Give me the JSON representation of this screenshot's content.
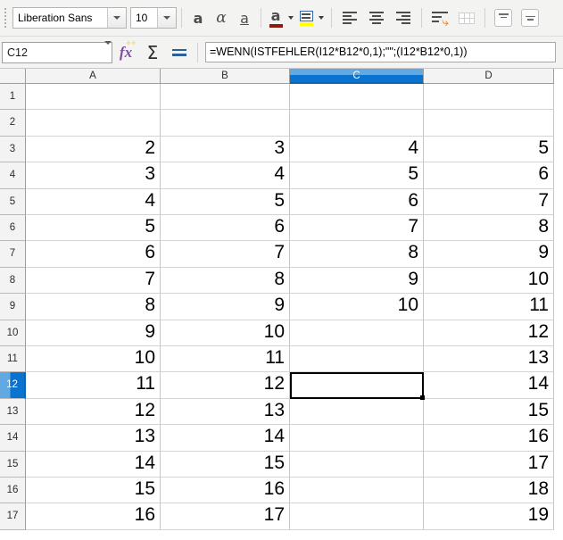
{
  "toolbar": {
    "font_name": "Liberation Sans",
    "font_size": "10",
    "bold_label": "a",
    "italic_label": "α",
    "underline_label": "a",
    "font_color_label": "a",
    "font_color_swatch": "#8b1a10",
    "highlight_color_swatch": "#ffff00"
  },
  "formula_bar": {
    "name_box_value": "C12",
    "formula": "=WENN(ISTFEHLER(I12*B12*0,1);\"\";(I12*B12*0,1))"
  },
  "sheet": {
    "selected_cell": "C12",
    "selected_column": "C",
    "selected_row": 12,
    "columns": [
      "A",
      "B",
      "C",
      "D"
    ],
    "rows": [
      1,
      2,
      3,
      4,
      5,
      6,
      7,
      8,
      9,
      10,
      11,
      12,
      13,
      14,
      15,
      16,
      17
    ],
    "data": {
      "1": {
        "A": "",
        "B": "",
        "C": "",
        "D": ""
      },
      "2": {
        "A": "",
        "B": "",
        "C": "",
        "D": ""
      },
      "3": {
        "A": "2",
        "B": "3",
        "C": "4",
        "D": "5"
      },
      "4": {
        "A": "3",
        "B": "4",
        "C": "5",
        "D": "6"
      },
      "5": {
        "A": "4",
        "B": "5",
        "C": "6",
        "D": "7"
      },
      "6": {
        "A": "5",
        "B": "6",
        "C": "7",
        "D": "8"
      },
      "7": {
        "A": "6",
        "B": "7",
        "C": "8",
        "D": "9"
      },
      "8": {
        "A": "7",
        "B": "8",
        "C": "9",
        "D": "10"
      },
      "9": {
        "A": "8",
        "B": "9",
        "C": "10",
        "D": "11"
      },
      "10": {
        "A": "9",
        "B": "10",
        "C": "",
        "D": "12"
      },
      "11": {
        "A": "10",
        "B": "11",
        "C": "",
        "D": "13"
      },
      "12": {
        "A": "11",
        "B": "12",
        "C": "",
        "D": "14"
      },
      "13": {
        "A": "12",
        "B": "13",
        "C": "",
        "D": "15"
      },
      "14": {
        "A": "13",
        "B": "14",
        "C": "",
        "D": "16"
      },
      "15": {
        "A": "14",
        "B": "15",
        "C": "",
        "D": "17"
      },
      "16": {
        "A": "15",
        "B": "16",
        "C": "",
        "D": "18"
      },
      "17": {
        "A": "16",
        "B": "17",
        "C": "",
        "D": "19"
      }
    }
  },
  "colors": {
    "header_selected": "#0a72cf",
    "header_background": "#f3f3f3",
    "grid_line": "#c6c6c6",
    "cursor": "#000000"
  }
}
